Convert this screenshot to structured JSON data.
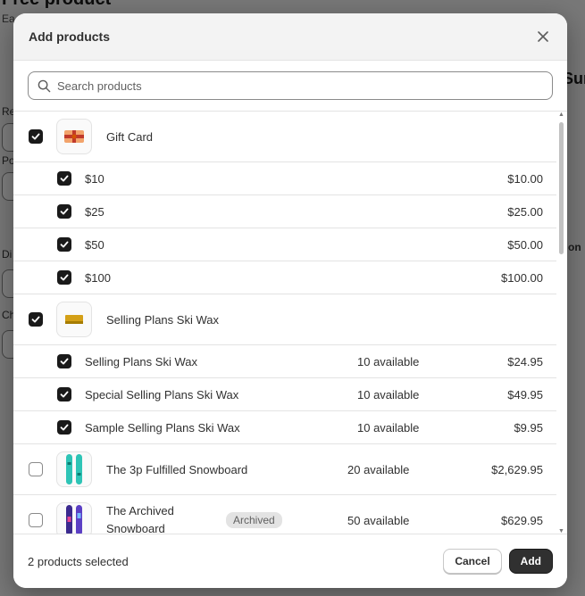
{
  "background": {
    "title": "Free product",
    "subtitle": "Ea",
    "right_heading": "Sur",
    "labels": [
      "Re",
      "Po",
      "Di",
      "Ch",
      "on"
    ]
  },
  "modal": {
    "title": "Add products",
    "close_icon": "close-icon"
  },
  "search": {
    "placeholder": "Search products",
    "value": ""
  },
  "products": [
    {
      "title": "Gift Card",
      "checked": true,
      "thumbnail": "gift-card",
      "variants": [
        {
          "title": "$10",
          "available": "",
          "price": "$10.00",
          "checked": true
        },
        {
          "title": "$25",
          "available": "",
          "price": "$25.00",
          "checked": true
        },
        {
          "title": "$50",
          "available": "",
          "price": "$50.00",
          "checked": true
        },
        {
          "title": "$100",
          "available": "",
          "price": "$100.00",
          "checked": true
        }
      ]
    },
    {
      "title": "Selling Plans Ski Wax",
      "checked": true,
      "thumbnail": "ski-wax",
      "variants": [
        {
          "title": "Selling Plans Ski Wax",
          "available": "10 available",
          "price": "$24.95",
          "checked": true
        },
        {
          "title": "Special Selling Plans Ski Wax",
          "available": "10 available",
          "price": "$49.95",
          "checked": true
        },
        {
          "title": "Sample Selling Plans Ski Wax",
          "available": "10 available",
          "price": "$9.95",
          "checked": true
        }
      ]
    },
    {
      "title": "The 3p Fulfilled Snowboard",
      "checked": false,
      "thumbnail": "snowboard-teal",
      "available": "20 available",
      "price": "$2,629.95"
    },
    {
      "title": "The Archived Snowboard",
      "checked": false,
      "thumbnail": "snowboard-purple",
      "badge": "Archived",
      "available": "50 available",
      "price": "$629.95"
    }
  ],
  "footer": {
    "selected_count": "2 products selected",
    "cancel_label": "Cancel",
    "add_label": "Add"
  }
}
